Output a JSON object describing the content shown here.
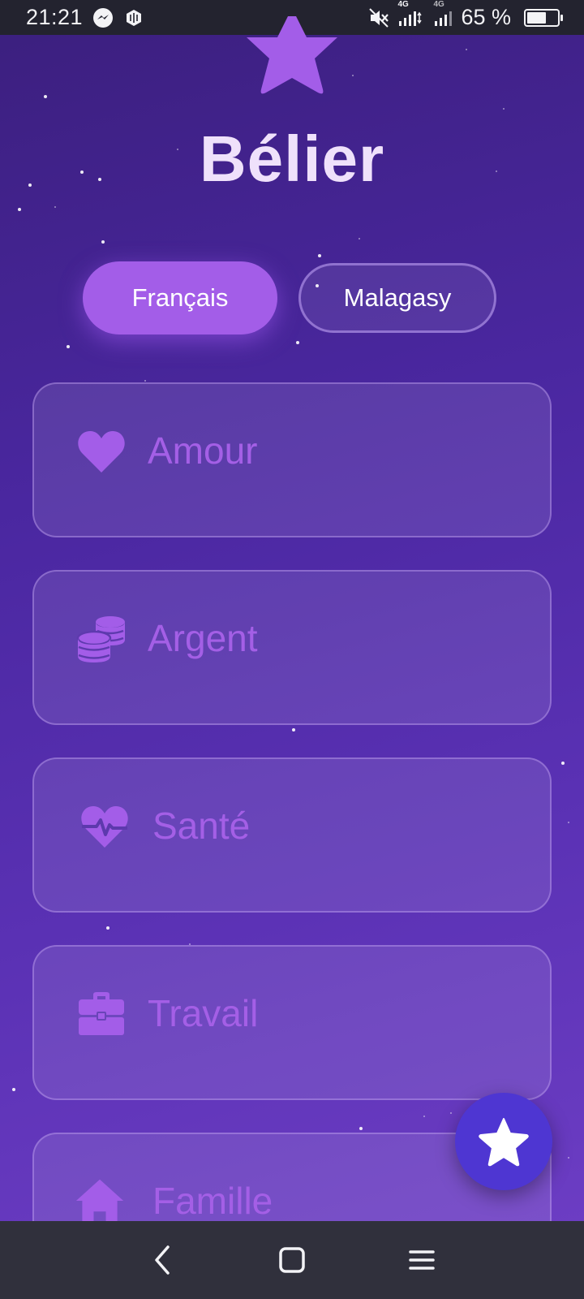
{
  "status_bar": {
    "time": "21:21",
    "network_labels": [
      "4G",
      "4G"
    ],
    "battery_text": "65 %",
    "battery_level": 0.65,
    "icons": [
      "messenger-icon",
      "app-notification-icon",
      "mute-icon",
      "signal-icon",
      "battery-icon"
    ]
  },
  "header": {
    "title": "Bélier",
    "icon": "star-icon",
    "star_color": "#a35de8"
  },
  "language_toggle": {
    "options": [
      {
        "label": "Français",
        "selected": true
      },
      {
        "label": "Malagasy",
        "selected": false
      }
    ]
  },
  "categories": [
    {
      "label": "Amour",
      "icon": "heart-icon"
    },
    {
      "label": "Argent",
      "icon": "coins-icon"
    },
    {
      "label": "Santé",
      "icon": "heart-pulse-icon"
    },
    {
      "label": "Travail",
      "icon": "briefcase-icon"
    },
    {
      "label": "Famille",
      "icon": "home-icon"
    }
  ],
  "fab": {
    "icon": "star-icon",
    "color": "#4e36d2"
  },
  "nav_bar": {
    "icons": [
      "back-icon",
      "home-square-icon",
      "menu-icon"
    ]
  },
  "colors": {
    "accent": "#a35de8",
    "label": "#a45fe6",
    "title": "#efe1fb",
    "background_top": "#3b1f7d",
    "background_bottom": "#6f3fc6"
  }
}
